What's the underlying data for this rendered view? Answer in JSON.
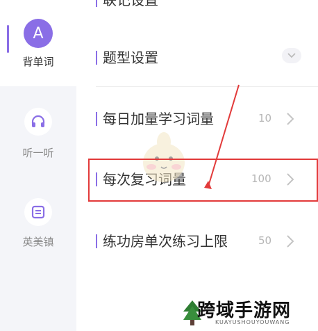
{
  "sidebar": {
    "items": [
      {
        "label": "背单词",
        "icon": "letter-a-icon",
        "icon_text": "A",
        "active": true
      },
      {
        "label": "听一听",
        "icon": "headphones-icon",
        "active": false
      },
      {
        "label": "英美镇",
        "icon": "town-icon",
        "active": false
      }
    ],
    "accent_color": "#8a6ee6"
  },
  "settings": {
    "top_partial": {
      "title": "联记设置"
    },
    "question_type": {
      "title": "题型设置",
      "expanded": false
    },
    "daily_new_words": {
      "title": "每日加量学习词量",
      "value": "10"
    },
    "review_words": {
      "title": "每次复习词量",
      "value": "100"
    },
    "practice_limit": {
      "title": "练功房单次练习上限",
      "value": "50"
    }
  },
  "annotation": {
    "highlight_color": "#e23a3a"
  },
  "watermark": {
    "title": "跨域手游网",
    "subtitle": "KUAYUSHOUYOUWANG"
  }
}
